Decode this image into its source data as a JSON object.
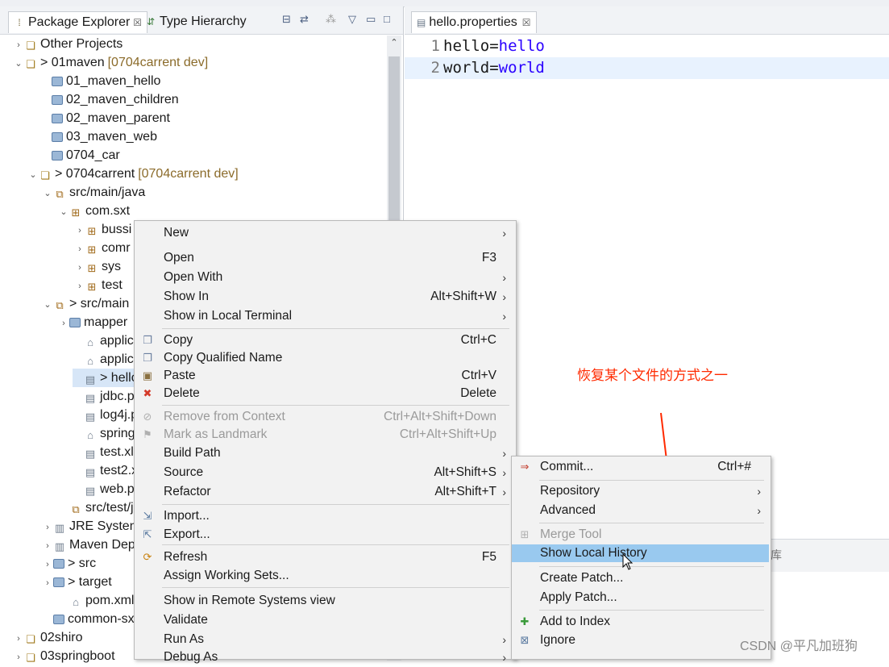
{
  "left_tabs": {
    "package_explorer": "Package Explorer",
    "type_hierarchy": "Type Hierarchy"
  },
  "tree": [
    {
      "twisty": ">",
      "icon": "project-icon",
      "label": "Other Projects",
      "dec": ""
    },
    {
      "twisty": "v",
      "icon": "project-icon",
      "label": "> 01maven",
      "dec": "[0704carrent dev]"
    },
    {
      "twisty": "",
      "icon": "folder-icon",
      "label": "01_maven_hello",
      "dec": ""
    },
    {
      "twisty": "",
      "icon": "folder-icon",
      "label": "02_maven_children",
      "dec": ""
    },
    {
      "twisty": "",
      "icon": "folder-icon",
      "label": "02_maven_parent",
      "dec": ""
    },
    {
      "twisty": "",
      "icon": "folder-icon",
      "label": "03_maven_web",
      "dec": ""
    },
    {
      "twisty": "",
      "icon": "folder-icon",
      "label": "0704_car",
      "dec": ""
    },
    {
      "twisty": "v",
      "icon": "project-icon",
      "label": "> 0704carrent",
      "dec": "[0704carrent dev]"
    },
    {
      "twisty": "v",
      "icon": "source-folder-icon",
      "label": "src/main/java",
      "dec": ""
    },
    {
      "twisty": "v",
      "icon": "package-icon",
      "label": "com.sxt",
      "dec": ""
    },
    {
      "twisty": ">",
      "icon": "package-icon",
      "label": "bussi",
      "dec": ""
    },
    {
      "twisty": ">",
      "icon": "package-icon",
      "label": "comr",
      "dec": ""
    },
    {
      "twisty": ">",
      "icon": "package-icon",
      "label": "sys",
      "dec": ""
    },
    {
      "twisty": ">",
      "icon": "package-icon",
      "label": "test",
      "dec": ""
    },
    {
      "twisty": "v",
      "icon": "source-folder-icon",
      "label": "> src/main",
      "dec": ""
    },
    {
      "twisty": ">",
      "icon": "folder-icon",
      "label": "mapper",
      "dec": ""
    },
    {
      "twisty": "",
      "icon": "xml-file-icon",
      "label": "applicat",
      "dec": ""
    },
    {
      "twisty": "",
      "icon": "xml-file-icon",
      "label": "applicat",
      "dec": ""
    },
    {
      "twisty": "",
      "icon": "properties-file-icon",
      "label": "> hello.",
      "dec": ""
    },
    {
      "twisty": "",
      "icon": "properties-file-icon",
      "label": "jdbc.pro",
      "dec": ""
    },
    {
      "twisty": "",
      "icon": "properties-file-icon",
      "label": "log4j.pr",
      "dec": ""
    },
    {
      "twisty": "",
      "icon": "xml-file-icon",
      "label": "springm",
      "dec": ""
    },
    {
      "twisty": "",
      "icon": "file-icon",
      "label": "test.xlsx",
      "dec": ""
    },
    {
      "twisty": "",
      "icon": "file-icon",
      "label": "test2.xls",
      "dec": ""
    },
    {
      "twisty": "",
      "icon": "properties-file-icon",
      "label": "web.pro",
      "dec": ""
    },
    {
      "twisty": "",
      "icon": "source-folder-icon",
      "label": "src/test/jav",
      "dec": ""
    },
    {
      "twisty": ">",
      "icon": "library-icon",
      "label": "JRE Systen",
      "dec": ""
    },
    {
      "twisty": ">",
      "icon": "library-icon",
      "label": "Maven Dep",
      "dec": ""
    },
    {
      "twisty": ">",
      "icon": "folder-icon",
      "label": "> src",
      "dec": ""
    },
    {
      "twisty": ">",
      "icon": "folder-icon",
      "label": "> target",
      "dec": ""
    },
    {
      "twisty": "",
      "icon": "xml-file-icon",
      "label": "pom.xml",
      "dec": ""
    },
    {
      "twisty": "",
      "icon": "folder-icon",
      "label": "common-sxt",
      "dec": ""
    },
    {
      "twisty": ">",
      "icon": "project-icon",
      "label": "02shiro",
      "dec": ""
    },
    {
      "twisty": ">",
      "icon": "project-icon",
      "label": "03springboot",
      "dec": ""
    }
  ],
  "editor": {
    "tab_label": "hello.properties",
    "lines": [
      {
        "num": "1",
        "key": "hello",
        "eq": "=",
        "val": "hello"
      },
      {
        "num": "2",
        "key": "world",
        "eq": "=",
        "val": "world"
      }
    ],
    "lower_text": "源库"
  },
  "annotation": "恢复某个文件的方式之一",
  "context_menu": [
    {
      "label": "New",
      "shortcut": "",
      "submenu": true,
      "icon": "",
      "disabled": false
    },
    {
      "label": "Open",
      "shortcut": "F3",
      "submenu": false,
      "icon": "",
      "disabled": false
    },
    {
      "label": "Open With",
      "shortcut": "",
      "submenu": true,
      "icon": "",
      "disabled": false
    },
    {
      "label": "Show In",
      "shortcut": "Alt+Shift+W",
      "submenu": true,
      "icon": "",
      "disabled": false
    },
    {
      "label": "Show in Local Terminal",
      "shortcut": "",
      "submenu": true,
      "icon": "",
      "disabled": false
    },
    {
      "label": "Copy",
      "shortcut": "Ctrl+C",
      "submenu": false,
      "icon": "copy-icon",
      "disabled": false
    },
    {
      "label": "Copy Qualified Name",
      "shortcut": "",
      "submenu": false,
      "icon": "copy-icon",
      "disabled": false
    },
    {
      "label": "Paste",
      "shortcut": "Ctrl+V",
      "submenu": false,
      "icon": "paste-icon",
      "disabled": false
    },
    {
      "label": "Delete",
      "shortcut": "Delete",
      "submenu": false,
      "icon": "delete-icon",
      "disabled": false
    },
    {
      "label": "Remove from Context",
      "shortcut": "Ctrl+Alt+Shift+Down",
      "submenu": false,
      "icon": "remove-context-icon",
      "disabled": true
    },
    {
      "label": "Mark as Landmark",
      "shortcut": "Ctrl+Alt+Shift+Up",
      "submenu": false,
      "icon": "landmark-icon",
      "disabled": true
    },
    {
      "label": "Build Path",
      "shortcut": "",
      "submenu": true,
      "icon": "",
      "disabled": false
    },
    {
      "label": "Source",
      "shortcut": "Alt+Shift+S",
      "submenu": true,
      "icon": "",
      "disabled": false
    },
    {
      "label": "Refactor",
      "shortcut": "Alt+Shift+T",
      "submenu": true,
      "icon": "",
      "disabled": false
    },
    {
      "label": "Import...",
      "shortcut": "",
      "submenu": false,
      "icon": "import-icon",
      "disabled": false
    },
    {
      "label": "Export...",
      "shortcut": "",
      "submenu": false,
      "icon": "export-icon",
      "disabled": false
    },
    {
      "label": "Refresh",
      "shortcut": "F5",
      "submenu": false,
      "icon": "refresh-icon",
      "disabled": false
    },
    {
      "label": "Assign Working Sets...",
      "shortcut": "",
      "submenu": false,
      "icon": "",
      "disabled": false
    },
    {
      "label": "Show in Remote Systems view",
      "shortcut": "",
      "submenu": false,
      "icon": "",
      "disabled": false
    },
    {
      "label": "Validate",
      "shortcut": "",
      "submenu": false,
      "icon": "",
      "disabled": false
    },
    {
      "label": "Run As",
      "shortcut": "",
      "submenu": true,
      "icon": "",
      "disabled": false
    },
    {
      "label": "Debug As",
      "shortcut": "",
      "submenu": true,
      "icon": "",
      "disabled": false
    }
  ],
  "team_menu": [
    {
      "label": "Commit...",
      "shortcut": "Ctrl+#",
      "submenu": false,
      "icon": "commit-icon",
      "disabled": false
    },
    {
      "label": "Repository",
      "shortcut": "",
      "submenu": true,
      "icon": "",
      "disabled": false
    },
    {
      "label": "Advanced",
      "shortcut": "",
      "submenu": true,
      "icon": "",
      "disabled": false
    },
    {
      "label": "Merge Tool",
      "shortcut": "",
      "submenu": false,
      "icon": "merge-tool-icon",
      "disabled": true
    },
    {
      "label": "Show Local History",
      "shortcut": "",
      "submenu": false,
      "icon": "",
      "disabled": false,
      "highlighted": true
    },
    {
      "label": "Create Patch...",
      "shortcut": "",
      "submenu": false,
      "icon": "",
      "disabled": false
    },
    {
      "label": "Apply Patch...",
      "shortcut": "",
      "submenu": false,
      "icon": "",
      "disabled": false
    },
    {
      "label": "Add to Index",
      "shortcut": "",
      "submenu": false,
      "icon": "add-icon",
      "disabled": false
    },
    {
      "label": "Ignore",
      "shortcut": "",
      "submenu": false,
      "icon": "ignore-icon",
      "disabled": false
    }
  ],
  "watermark": "CSDN @平凡加班狗"
}
